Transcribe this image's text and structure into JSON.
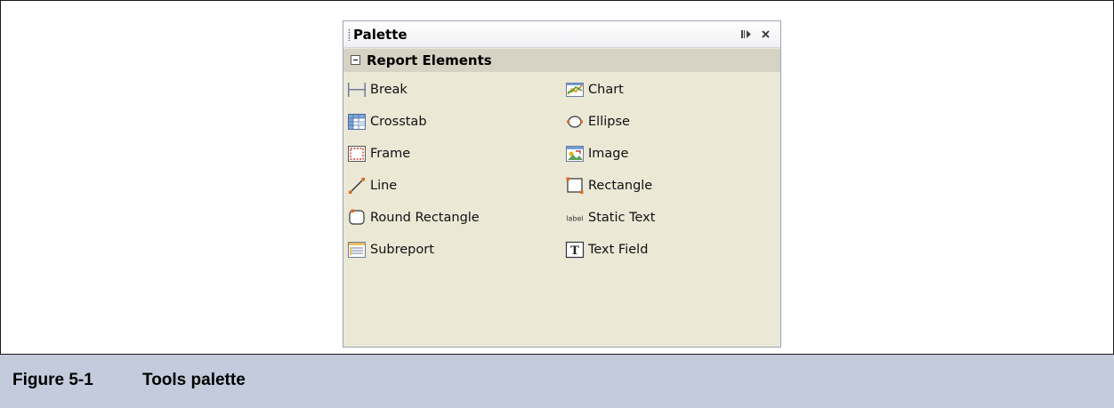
{
  "palette": {
    "title": "Palette",
    "category": "Report Elements",
    "items": [
      {
        "label": "Break",
        "icon": "break-icon"
      },
      {
        "label": "Chart",
        "icon": "chart-icon"
      },
      {
        "label": "Crosstab",
        "icon": "crosstab-icon"
      },
      {
        "label": "Ellipse",
        "icon": "ellipse-icon"
      },
      {
        "label": "Frame",
        "icon": "frame-icon"
      },
      {
        "label": "Image",
        "icon": "image-icon"
      },
      {
        "label": "Line",
        "icon": "line-icon"
      },
      {
        "label": "Rectangle",
        "icon": "rectangle-icon"
      },
      {
        "label": "Round Rectangle",
        "icon": "round-rectangle-icon"
      },
      {
        "label": "Static Text",
        "icon": "static-text-icon",
        "icon_text": "label"
      },
      {
        "label": "Subreport",
        "icon": "subreport-icon"
      },
      {
        "label": "Text Field",
        "icon": "text-field-icon",
        "icon_text": "T"
      }
    ]
  },
  "caption": {
    "number": "Figure 5-1",
    "title": "Tools palette"
  },
  "colors": {
    "palette_bg": "#ebe8d6",
    "category_bg": "#d6d2c4",
    "caption_bg": "#c3cbdc"
  }
}
